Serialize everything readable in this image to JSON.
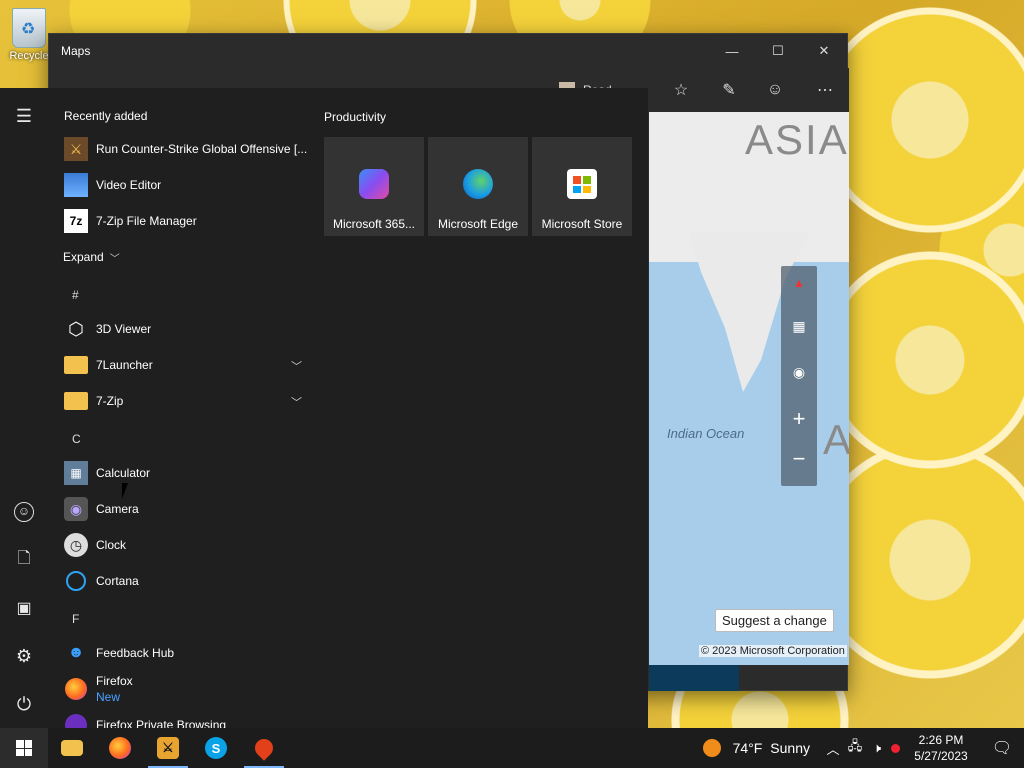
{
  "desktop": {
    "recycle_bin_label": "Recycle"
  },
  "maps_window": {
    "title": "Maps",
    "controls": {
      "minimize": "—",
      "maximize": "☐",
      "close": "✕"
    },
    "toolbar_partial_text": "Road",
    "map": {
      "label_asia": "ASIA",
      "label_australia": "AU",
      "label_ocean": "Indian Ocean",
      "suggest_button": "Suggest a change",
      "copyright": "© 2023 Microsoft Corporation"
    }
  },
  "start_menu": {
    "recently_added_title": "Recently added",
    "recent_apps": [
      {
        "label": "Run Counter-Strike Global Offensive [...",
        "icon": "csgo-icon"
      },
      {
        "label": "Video Editor",
        "icon": "video-editor-icon"
      },
      {
        "label": "7-Zip File Manager",
        "icon": "7zip-icon"
      }
    ],
    "expand_label": "Expand",
    "letters": [
      "#",
      "C",
      "F"
    ],
    "apps_hash": [
      {
        "label": "3D Viewer",
        "icon": "3d-viewer-icon"
      },
      {
        "label": "7Launcher",
        "icon": "folder-icon"
      },
      {
        "label": "7-Zip",
        "icon": "folder-icon"
      }
    ],
    "apps_c": [
      {
        "label": "Calculator",
        "icon": "calculator-icon"
      },
      {
        "label": "Camera",
        "icon": "camera-icon"
      },
      {
        "label": "Clock",
        "icon": "clock-icon"
      },
      {
        "label": "Cortana",
        "icon": "cortana-icon"
      }
    ],
    "apps_f": [
      {
        "label": "Feedback Hub",
        "icon": "feedback-hub-icon"
      },
      {
        "label": "Firefox",
        "sublabel": "New",
        "icon": "firefox-icon"
      },
      {
        "label": "Firefox Private Browsing",
        "icon": "firefox-private-icon"
      }
    ],
    "tiles_title": "Productivity",
    "tiles": [
      {
        "label": "Microsoft 365...",
        "icon": "microsoft-365-icon"
      },
      {
        "label": "Microsoft Edge",
        "icon": "edge-icon"
      },
      {
        "label": "Microsoft Store",
        "icon": "store-icon"
      }
    ]
  },
  "taskbar": {
    "weather_temp": "74°F",
    "weather_desc": "Sunny",
    "time": "2:26 PM",
    "date": "5/27/2023"
  }
}
